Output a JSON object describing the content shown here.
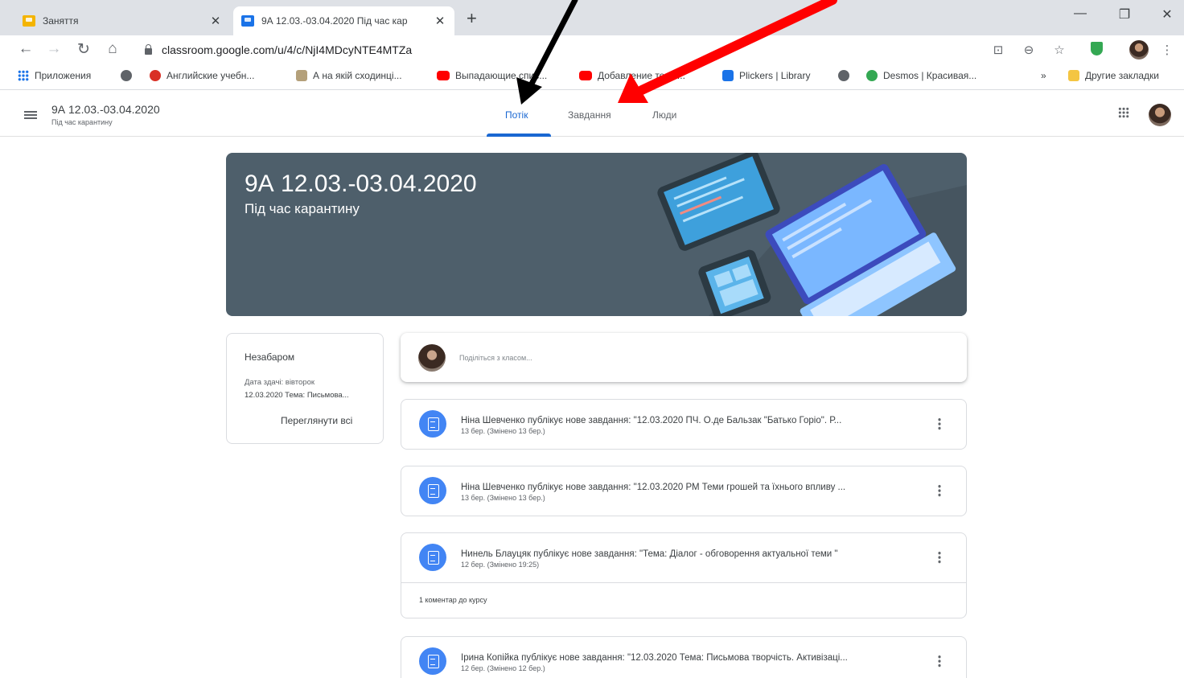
{
  "browser": {
    "tabs": [
      {
        "title": "Заняття",
        "favicon": "classroom-yellow-icon"
      },
      {
        "title": "9А 12.03.-03.04.2020 Під час кар",
        "favicon": "classroom-blue-icon"
      }
    ],
    "close_glyph": "✕",
    "newtab_glyph": "+",
    "window_controls": [
      "—",
      "❐",
      "✕"
    ],
    "url": "classroom.google.com/u/4/c/NjI4MDcyNTE4MTZa",
    "bookmarks": [
      {
        "label": "Приложения",
        "icon": "apps-grid-icon"
      },
      {
        "label": "",
        "icon": "globe-icon"
      },
      {
        "label": "Английские учебн...",
        "icon": "cherry-icon"
      },
      {
        "label": "А на якій сходинці...",
        "icon": "bookmark-icon"
      },
      {
        "label": "Выпадающие спис...",
        "icon": "youtube-icon"
      },
      {
        "label": "Добавление текст...",
        "icon": "youtube-icon"
      },
      {
        "label": "Plickers | Library",
        "icon": "plickers-icon"
      },
      {
        "label": "",
        "icon": "globe-icon"
      },
      {
        "label": "Desmos | Красивая...",
        "icon": "desmos-icon"
      }
    ],
    "bookmarks_more": "»",
    "other_bookmarks": "Другие закладки",
    "colors": {
      "tabstrip": "#dee1e6",
      "accent": "#1a73e8"
    }
  },
  "classroom": {
    "class_name": "9А 12.03.-03.04.2020",
    "class_section": "Під час карантину",
    "nav_tabs": [
      "Потік",
      "Завдання",
      "Люди"
    ],
    "active_tab": "Потік",
    "banner": {
      "title": "9А 12.03.-03.04.2020",
      "subtitle": "Під час карантину",
      "color": "#4e5f6b"
    },
    "upcoming": {
      "title": "Незабаром",
      "line1": "Дата здачі: вівторок",
      "line2": "12.03.2020 Тема: Письмова...",
      "view_all": "Переглянути всі"
    },
    "share_placeholder": "Поділіться з класом...",
    "posts": [
      {
        "title": "Ніна Шевченко публікує нове завдання: \"12.03.2020 ПЧ. О.де Бальзак \"Батько Горіо\". Р...",
        "date": "13 бер. (Змінено 13 бер.)",
        "comments": ""
      },
      {
        "title": "Ніна Шевченко публікує нове завдання: \"12.03.2020 РМ Теми грошей та їхнього впливу ...",
        "date": "13 бер. (Змінено 13 бер.)",
        "comments": ""
      },
      {
        "title": "Нинель Блауцяк публікує нове завдання: \"Тема: Діалог - обговорення актуальної теми \"",
        "date": "12 бер. (Змінено 19:25)",
        "comments": "1 коментар до курсу"
      },
      {
        "title": "Ірина Копійка публікує нове завдання: \"12.03.2020 Тема: Письмова творчість. Активізаці...",
        "date": "12 бер. (Змінено 12 бер.)",
        "comments": ""
      }
    ],
    "colors": {
      "primary": "#1967d2",
      "assignment_icon": "#4285f4",
      "annotation_red": "#ff0000"
    }
  }
}
